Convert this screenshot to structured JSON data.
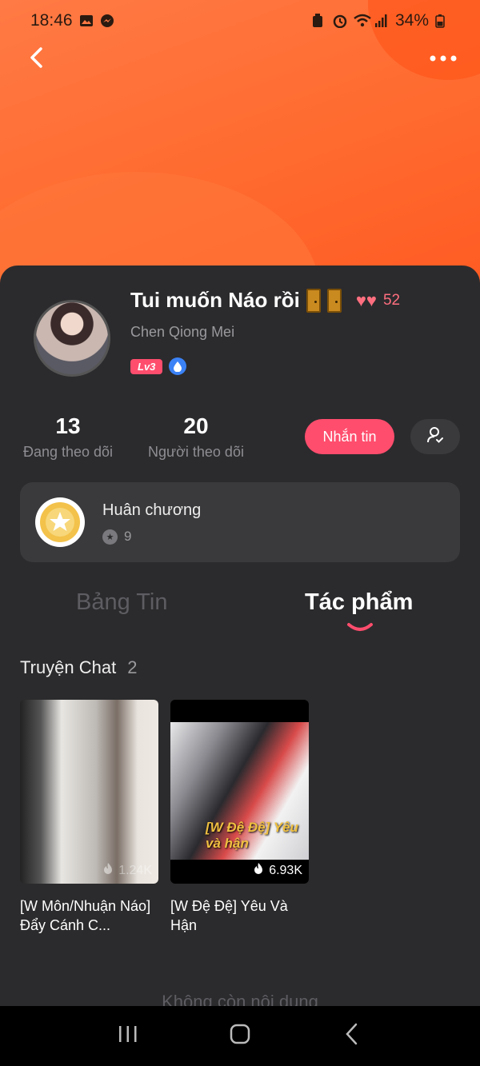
{
  "status_bar": {
    "time": "18:46",
    "battery": "34%"
  },
  "header": {
    "back_icon": "chevron-left-icon",
    "more_icon": "more-dots-icon"
  },
  "profile": {
    "name": "Tui muốn Náo rồi",
    "heart_count": "52",
    "subname": "Chen Qiong Mei",
    "level": "Lv3"
  },
  "stats": {
    "following_count": "13",
    "following_label": "Đang theo dõi",
    "followers_count": "20",
    "followers_label": "Người theo dõi"
  },
  "actions": {
    "message_label": "Nhắn tin"
  },
  "medal": {
    "title": "Huân chương",
    "count": "9"
  },
  "tabs": [
    {
      "label": "Bảng Tin",
      "active": false
    },
    {
      "label": "Tác phẩm",
      "active": true
    }
  ],
  "section": {
    "title": "Truyện Chat",
    "count": "2"
  },
  "stories": [
    {
      "title": "[W Môn/Nhuận Náo] Đẩy Cánh C...",
      "views": "1.24K"
    },
    {
      "title": "[W Đệ Đệ] Yêu Và Hận",
      "views": "6.93K",
      "overlay": "[W Đệ Đệ] Yêu và hận"
    }
  ],
  "footer": {
    "end_text": "Không còn nội dung"
  },
  "colors": {
    "accent": "#ff4d6d",
    "header_orange": "#ff6a2e",
    "panel_bg": "#2b2b2d"
  }
}
